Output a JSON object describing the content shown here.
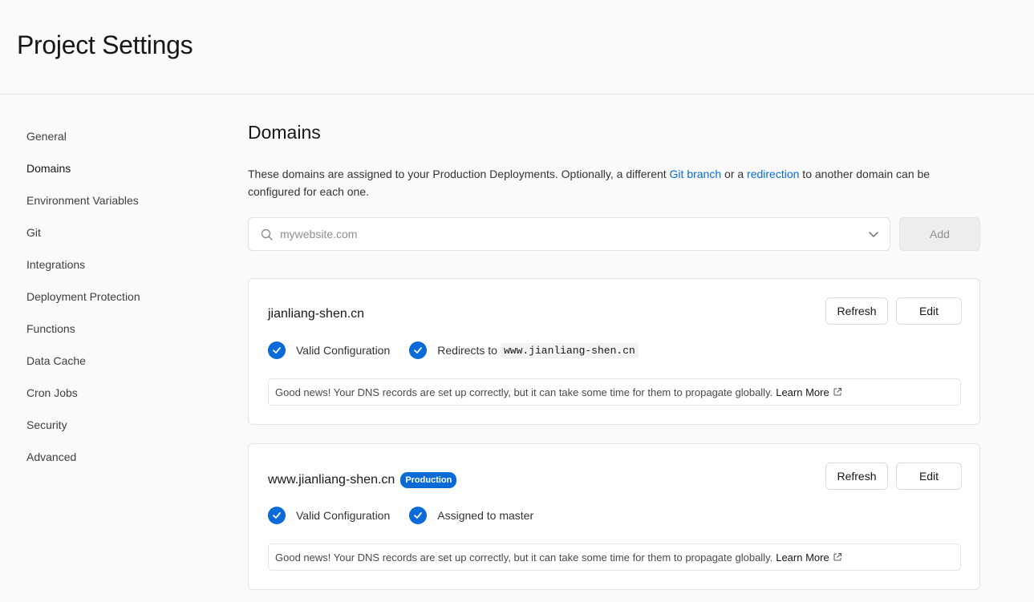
{
  "header": {
    "title": "Project Settings"
  },
  "sidebar": {
    "items": [
      {
        "label": "General"
      },
      {
        "label": "Domains"
      },
      {
        "label": "Environment Variables"
      },
      {
        "label": "Git"
      },
      {
        "label": "Integrations"
      },
      {
        "label": "Deployment Protection"
      },
      {
        "label": "Functions"
      },
      {
        "label": "Data Cache"
      },
      {
        "label": "Cron Jobs"
      },
      {
        "label": "Security"
      },
      {
        "label": "Advanced"
      }
    ],
    "active": "Domains"
  },
  "main": {
    "title": "Domains",
    "description": {
      "part1": "These domains are assigned to your Production Deployments. Optionally, a different ",
      "link1": "Git branch",
      "part2": " or a ",
      "link2": "redirection",
      "part3": " to another domain can be configured for each one."
    },
    "search": {
      "placeholder": "mywebsite.com",
      "value": ""
    },
    "add_label": "Add",
    "domains": [
      {
        "name": "jianliang-shen.cn",
        "badge": "",
        "refresh_label": "Refresh",
        "edit_label": "Edit",
        "status1": "Valid Configuration",
        "status2_prefix": "Redirects to",
        "status2_code": "www.jianliang-shen.cn",
        "notice": "Good news! Your DNS records are set up correctly, but it can take some time for them to propagate globally.",
        "learn_more": "Learn More"
      },
      {
        "name": "www.jianliang-shen.cn",
        "badge": "Production",
        "refresh_label": "Refresh",
        "edit_label": "Edit",
        "status1": "Valid Configuration",
        "status2_prefix": "Assigned to master",
        "status2_code": "",
        "notice": "Good news! Your DNS records are set up correctly, but it can take some time for them to propagate globally.",
        "learn_more": "Learn More"
      }
    ]
  },
  "colors": {
    "accent": "#0a6bd6",
    "background": "#fafafa"
  },
  "icons": [
    "search-icon",
    "chevron-down-icon",
    "check-circle-icon",
    "external-link-icon"
  ]
}
